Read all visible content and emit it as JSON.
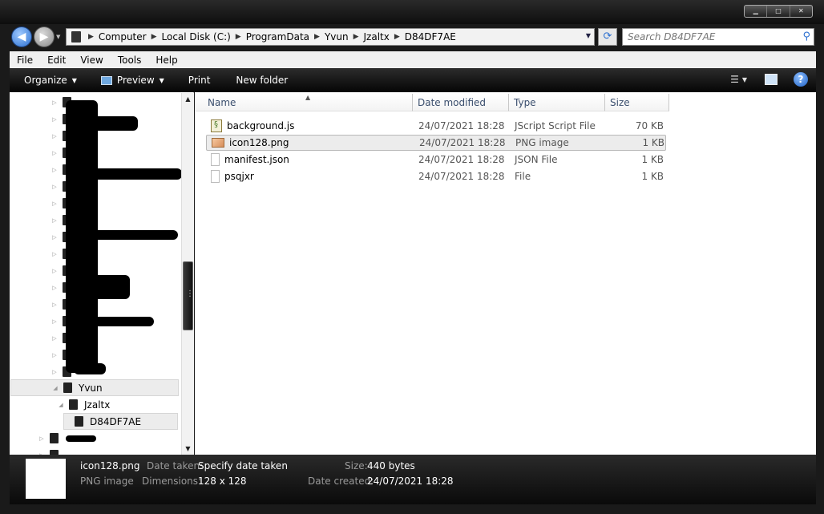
{
  "window": {
    "caption_buttons": [
      "▁",
      "□",
      "✕"
    ]
  },
  "address_bar": {
    "breadcrumbs": [
      "Computer",
      "Local Disk (C:)",
      "ProgramData",
      "Yvun",
      "Jzaltx",
      "D84DF7AE"
    ],
    "separator": "▶"
  },
  "search": {
    "placeholder": "Search D84DF7AE"
  },
  "menu": {
    "items": [
      "File",
      "Edit",
      "View",
      "Tools",
      "Help"
    ]
  },
  "toolbar": {
    "organize": "Organize",
    "preview": "Preview",
    "print": "Print",
    "new_folder": "New folder"
  },
  "nav_tree": {
    "visible_items": [
      {
        "label": "Yvun",
        "level": 0,
        "expanded": true
      },
      {
        "label": "Jzaltx",
        "level": 1,
        "expanded": true
      },
      {
        "label": "D84DF7AE",
        "level": 2,
        "selected": true
      }
    ]
  },
  "columns": {
    "name": "Name",
    "date": "Date modified",
    "type": "Type",
    "size": "Size"
  },
  "files": [
    {
      "name": "background.js",
      "date": "24/07/2021 18:28",
      "type": "JScript Script File",
      "size": "70 KB",
      "icon": "js-file-icon"
    },
    {
      "name": "icon128.png",
      "date": "24/07/2021 18:28",
      "type": "PNG image",
      "size": "1 KB",
      "icon": "png-file-icon",
      "selected": true
    },
    {
      "name": "manifest.json",
      "date": "24/07/2021 18:28",
      "type": "JSON File",
      "size": "1 KB",
      "icon": "json-file-icon"
    },
    {
      "name": "psqjxr",
      "date": "24/07/2021 18:28",
      "type": "File",
      "size": "1 KB",
      "icon": "file-icon"
    }
  ],
  "details": {
    "filename": "icon128.png",
    "filetype": "PNG image",
    "date_taken_label": "Date taken:",
    "date_taken_value": "Specify date taken",
    "dimensions_label": "Dimensions:",
    "dimensions_value": "128 x 128",
    "size_label": "Size:",
    "size_value": "440 bytes",
    "date_created_label": "Date created:",
    "date_created_value": "24/07/2021 18:28"
  },
  "colors": {
    "accent": "#2b6fd0",
    "toolbar_bg": "#050505",
    "selection_bg": "#ececec"
  }
}
